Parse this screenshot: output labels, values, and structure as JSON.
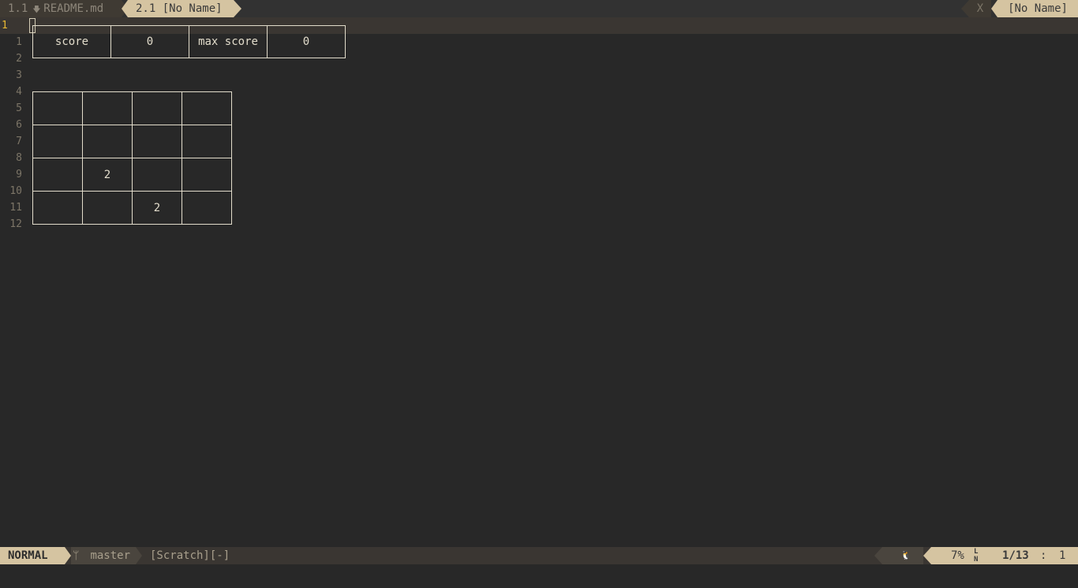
{
  "tabline": {
    "inactive_tab": {
      "number": "1.1",
      "modified_icon": "modified-arrow-icon",
      "name": "README.md"
    },
    "active_tab": {
      "label": "2.1 [No Name]"
    },
    "close_label": "X",
    "right_label": "[No Name]"
  },
  "editor": {
    "current_line": "1",
    "line_numbers": [
      "1",
      "2",
      "3",
      "4",
      "5",
      "6",
      "7",
      "8",
      "9",
      "10",
      "11",
      "12"
    ],
    "score_table": {
      "score_label": "score",
      "score_value": "0",
      "max_score_label": "max score",
      "max_score_value": "0"
    },
    "board": [
      [
        "",
        "",
        "",
        ""
      ],
      [
        "",
        "",
        "",
        ""
      ],
      [
        "",
        "2",
        "",
        ""
      ],
      [
        "",
        "",
        "2",
        ""
      ]
    ]
  },
  "statusline": {
    "mode": "NORMAL",
    "branch_icon": "git-branch-icon",
    "branch": "master",
    "file": "[Scratch][-]",
    "encoding_icon": "linux-icon",
    "percent": "7%",
    "ln_icon_top": "L",
    "ln_icon_bottom": "N",
    "line": "1/13",
    "col_sep": ":",
    "col": "1"
  },
  "colors": {
    "background": "#282828",
    "tab_active": "#d5c4a1",
    "tab_inactive": "#3f3a33",
    "current_line_number": "#e8b833",
    "text": "#e2dccb"
  }
}
